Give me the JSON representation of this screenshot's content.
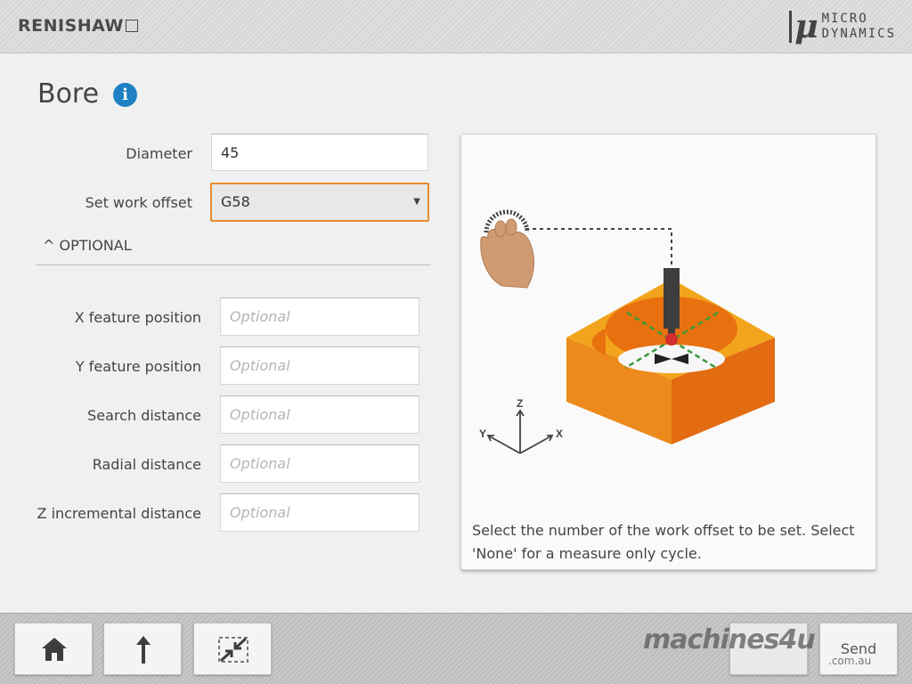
{
  "header": {
    "brand_left": "RENISHAW",
    "brand_right_mark": "μ",
    "brand_right_line1": "MICRO",
    "brand_right_line2": "DYNAMICS"
  },
  "page": {
    "title": "Bore",
    "info_icon": "info-icon"
  },
  "form": {
    "diameter": {
      "label": "Diameter",
      "value": "45"
    },
    "work_offset": {
      "label": "Set work offset",
      "value": "G58"
    },
    "optional_toggle": "^ OPTIONAL",
    "optional_fields": [
      {
        "label": "X feature position",
        "placeholder": "Optional"
      },
      {
        "label": "Y feature position",
        "placeholder": "Optional"
      },
      {
        "label": "Search distance",
        "placeholder": "Optional"
      },
      {
        "label": "Radial distance",
        "placeholder": "Optional"
      },
      {
        "label": "Z incremental distance",
        "placeholder": "Optional"
      }
    ]
  },
  "help_panel": {
    "description": "Select the number of the work offset to be set. Select 'None' for a measure only cycle.",
    "axis_z": "Z",
    "axis_y": "Y",
    "axis_x": "X"
  },
  "footer": {
    "home_icon": "home-icon",
    "up_icon": "arrow-up-icon",
    "collapse_icon": "collapse-icon",
    "send_label": "Send",
    "watermark": "machines4u",
    "watermark_sub": ".com.au"
  },
  "colors": {
    "accent_orange": "#e58c2c",
    "info_blue": "#1f80c4",
    "block_top": "#f2a51c",
    "block_left": "#ec8a1b",
    "block_right": "#e36b12",
    "bore_inner": "#e9700f",
    "guide_green": "#3a9a3a",
    "probe_red": "#d32d2d"
  }
}
